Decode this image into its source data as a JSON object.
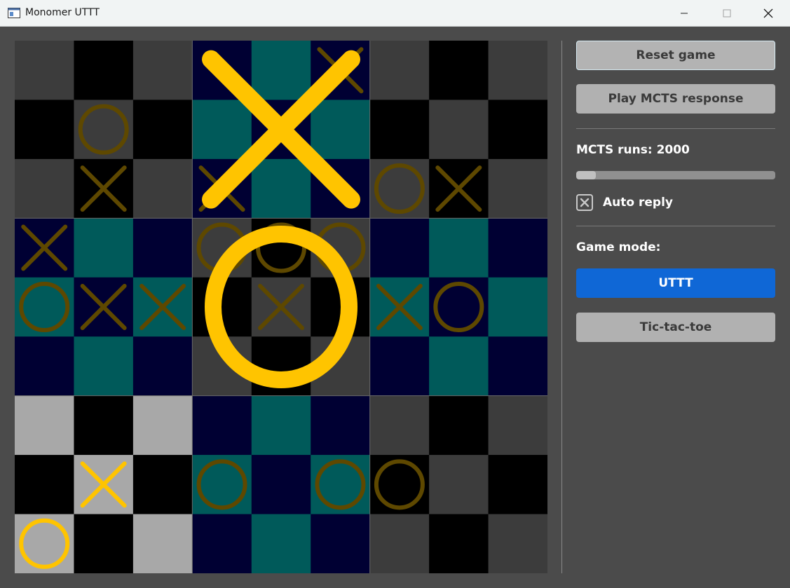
{
  "window": {
    "title": "Monomer UTTT",
    "icon": "app-window-icon",
    "controls": [
      "minimize-icon",
      "maximize-icon",
      "close-icon"
    ]
  },
  "board": {
    "description_colors": {
      "dark_gray": "#3c3c3c",
      "black": "#000000",
      "teal": "#005a5a",
      "navy": "#000033",
      "light_gray": "#a8a8a8",
      "mark_inactive": "#5e4800",
      "mark_active": "#ffc400"
    },
    "sub_boards": [
      {
        "index": 0,
        "palette": "gray",
        "winner": ""
      },
      {
        "index": 1,
        "palette": "teal",
        "winner": "X"
      },
      {
        "index": 2,
        "palette": "gray",
        "winner": ""
      },
      {
        "index": 3,
        "palette": "teal",
        "winner": ""
      },
      {
        "index": 4,
        "palette": "gray",
        "winner": "O"
      },
      {
        "index": 5,
        "palette": "teal",
        "winner": ""
      },
      {
        "index": 6,
        "palette": "light",
        "winner": ""
      },
      {
        "index": 7,
        "palette": "teal",
        "winner": ""
      },
      {
        "index": 8,
        "palette": "gray",
        "winner": ""
      }
    ],
    "cells": [
      [
        "",
        "",
        "",
        "",
        "",
        "X",
        "",
        "",
        ""
      ],
      [
        "",
        "O",
        "",
        "",
        "",
        "",
        "",
        "",
        ""
      ],
      [
        "",
        "X",
        "",
        "X",
        "",
        "",
        "O",
        "X",
        ""
      ],
      [
        "X",
        "",
        "",
        "O",
        "O",
        "O",
        "",
        "",
        ""
      ],
      [
        "O",
        "X",
        "X",
        "",
        "X",
        "",
        "X",
        "O",
        ""
      ],
      [
        "",
        "",
        "",
        "",
        "",
        "",
        "",
        "",
        ""
      ],
      [
        "",
        "",
        "",
        "",
        "",
        "",
        "",
        "",
        ""
      ],
      [
        "",
        "X",
        "",
        "O",
        "",
        "O",
        "O",
        "",
        ""
      ],
      [
        "O",
        "",
        "",
        "",
        "",
        "",
        "",
        "",
        ""
      ]
    ],
    "active_sub_board": 6
  },
  "panel": {
    "reset_label": "Reset game",
    "play_label": "Play MCTS response",
    "mcts_runs_label": "MCTS runs: 2000",
    "mcts_progress": 0.1,
    "auto_reply_label": "Auto reply",
    "auto_reply_checked": true,
    "game_mode_label": "Game mode:",
    "mode_uttt_label": "UTTT",
    "mode_ttt_label": "Tic-tac-toe",
    "selected_mode": "UTTT"
  }
}
